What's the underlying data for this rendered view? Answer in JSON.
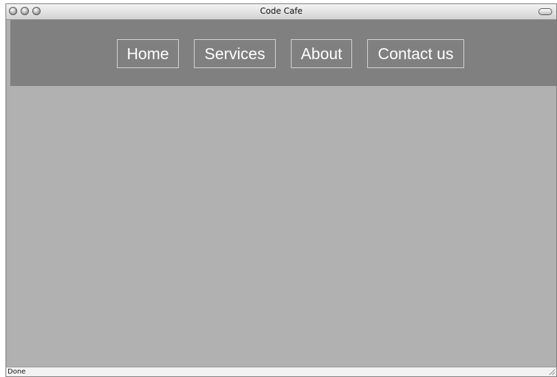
{
  "window": {
    "title": "Code Cafe"
  },
  "nav": {
    "items": [
      {
        "label": "Home"
      },
      {
        "label": "Services"
      },
      {
        "label": "About"
      },
      {
        "label": "Contact us"
      }
    ]
  },
  "statusbar": {
    "text": "Done"
  },
  "icons": {
    "close": "close-button-icon",
    "minimize": "minimize-button-icon",
    "zoom": "zoom-button-icon",
    "toolbar_toggle": "toolbar-toggle-icon",
    "resize": "resize-grip-icon"
  },
  "colors": {
    "nav_background": "#808080",
    "page_background": "#b1b1b1",
    "nav_text": "#ffffff"
  }
}
